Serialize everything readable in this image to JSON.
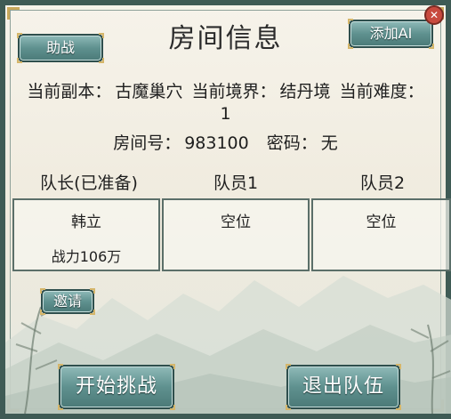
{
  "window": {
    "title": "房间信息",
    "assist_button": "助战",
    "add_ai_button": "添加AI"
  },
  "room": {
    "dungeon_label": "当前副本：",
    "dungeon_value": "古魔巢穴",
    "realm_label": "当前境界：",
    "realm_value": "结丹境",
    "difficulty_label": "当前难度：",
    "difficulty_value": "1",
    "room_no_label": "房间号：",
    "room_no_value": "983100",
    "password_label": "密码：",
    "password_value": "无"
  },
  "team": {
    "headers": [
      "队长(已准备)",
      "队员1",
      "队员2"
    ],
    "slots": [
      {
        "name": "韩立",
        "power": "战力106万"
      },
      {
        "name": "空位",
        "power": ""
      },
      {
        "name": "空位",
        "power": ""
      }
    ]
  },
  "actions": {
    "invite": "邀请",
    "start": "开始挑战",
    "leave": "退出队伍"
  },
  "colors": {
    "frame": "#3f5b55",
    "button": "#5f918f",
    "accent_gold": "#c9a85b",
    "close": "#c84a3e"
  }
}
